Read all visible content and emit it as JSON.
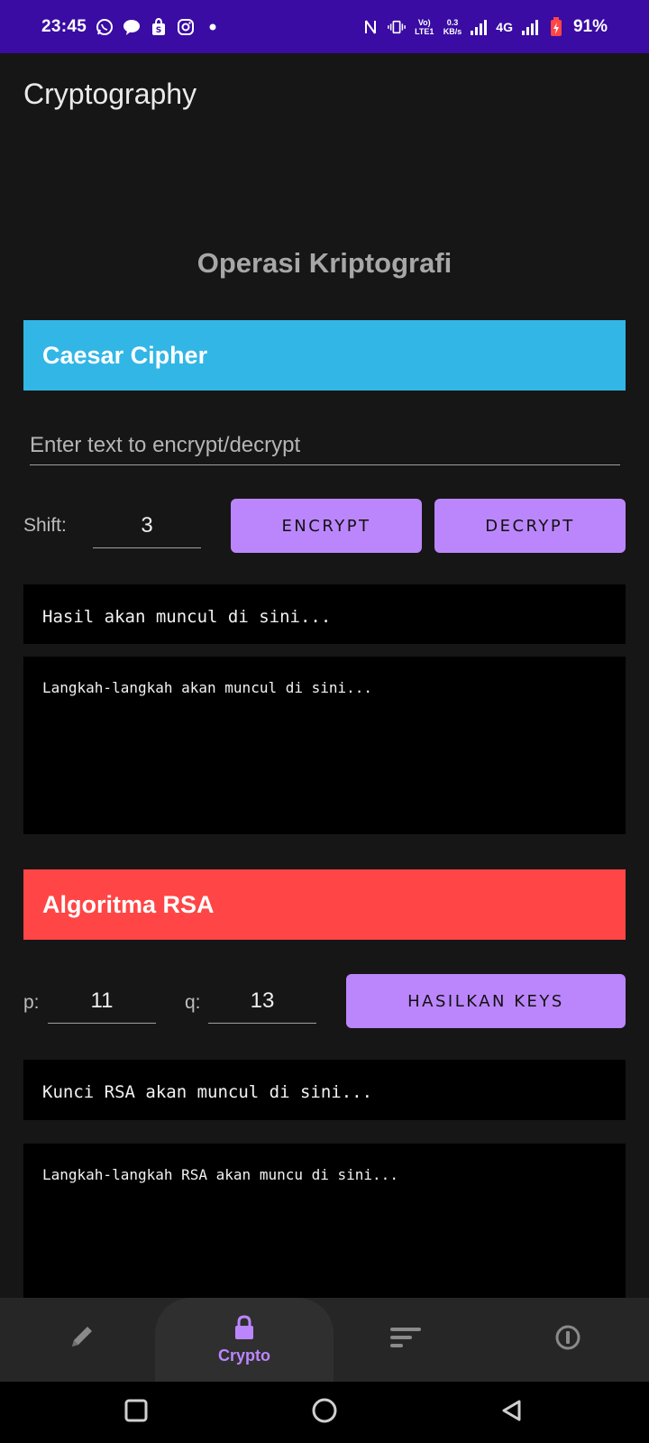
{
  "status_bar": {
    "time": "23:45",
    "left_icons": [
      "whatsapp-icon",
      "message-icon",
      "shopping-bag-icon",
      "instagram-icon",
      "dot-icon"
    ],
    "net_type": "Vo) LTE1",
    "net_speed_value": "0.3",
    "net_speed_unit": "KB/s",
    "network_4g": "4G",
    "battery": "91%"
  },
  "app_bar": {
    "title": "Cryptography"
  },
  "page": {
    "heading": "Operasi Kriptografi"
  },
  "caesar": {
    "title": "Caesar Cipher",
    "input_placeholder": "Enter text to encrypt/decrypt",
    "input_value": "",
    "shift_label": "Shift:",
    "shift_value": "3",
    "encrypt_label": "ENCRYPT",
    "decrypt_label": "DECRYPT",
    "result_text": "Hasil akan muncul di sini...",
    "steps_text": "Langkah-langkah akan muncul di sini..."
  },
  "rsa": {
    "title": "Algoritma RSA",
    "p_label": "p:",
    "p_value": "11",
    "q_label": "q:",
    "q_value": "13",
    "generate_label": "HASILKAN KEYS",
    "keys_text": "Kunci RSA akan muncul di sini...",
    "steps_text": "Langkah-langkah RSA akan muncu di sini..."
  },
  "bottom_nav": {
    "items": [
      {
        "icon": "pencil-icon",
        "label": ""
      },
      {
        "icon": "lock-icon",
        "label": "Crypto",
        "active": true
      },
      {
        "icon": "sort-icon",
        "label": ""
      },
      {
        "icon": "info-icon",
        "label": ""
      }
    ],
    "active_color": "#bb86fc",
    "inactive_color": "#8a8a8a"
  },
  "colors": {
    "status_bar": "#3a0ca3",
    "caesar_banner": "#32b6e6",
    "rsa_banner": "#ff4545",
    "button": "#bb86fc",
    "background": "#161616"
  }
}
